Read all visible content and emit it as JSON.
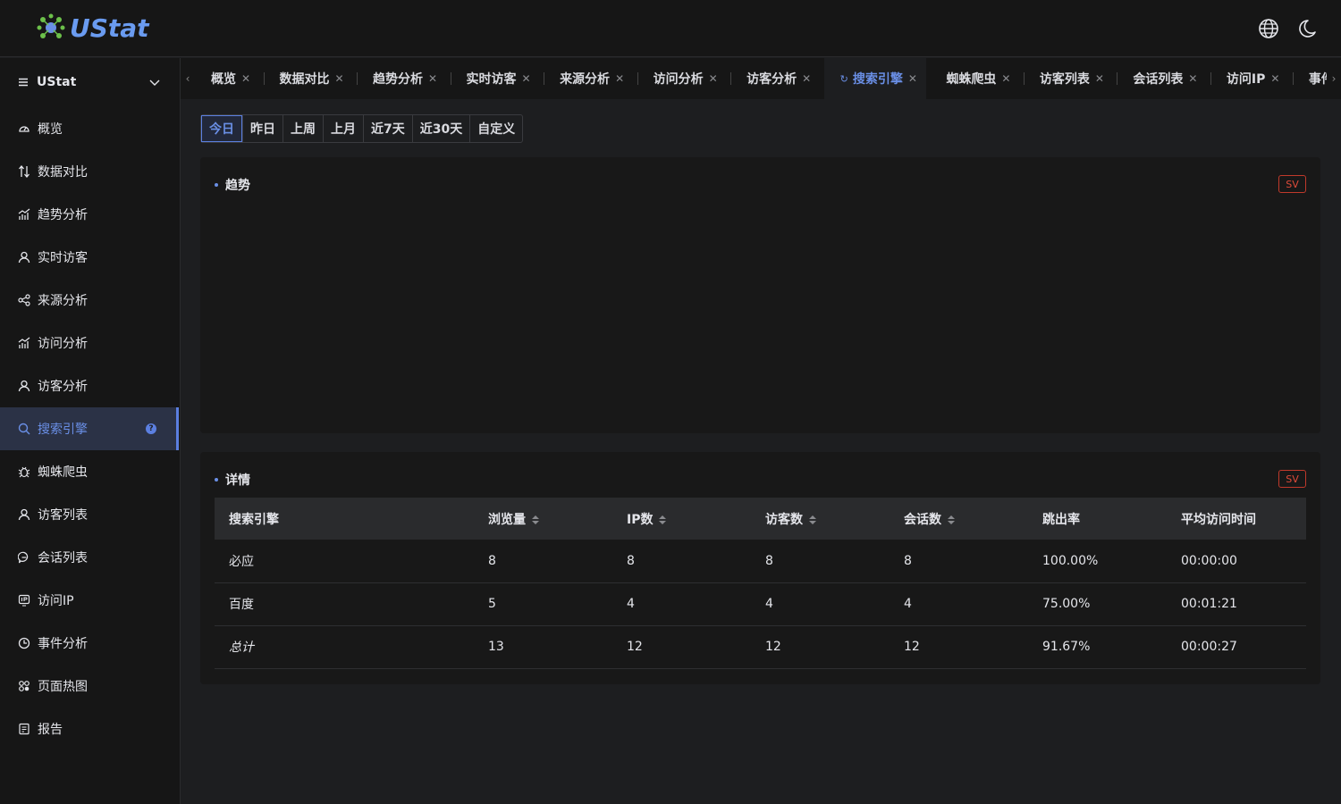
{
  "app": {
    "logo_text": "UStat"
  },
  "colors": {
    "accent": "#5b7fe0",
    "logo_green": "#6cc04a",
    "sv_red": "#e04b3a"
  },
  "sidebar": {
    "site_label": "UStat",
    "items": [
      {
        "label": "概览",
        "icon": "dashboard-icon"
      },
      {
        "label": "数据对比",
        "icon": "compare-icon"
      },
      {
        "label": "趋势分析",
        "icon": "trend-chart-icon"
      },
      {
        "label": "实时访客",
        "icon": "user-icon"
      },
      {
        "label": "来源分析",
        "icon": "share-icon"
      },
      {
        "label": "访问分析",
        "icon": "bar-chart-icon"
      },
      {
        "label": "访客分析",
        "icon": "user-icon"
      },
      {
        "label": "搜索引擎",
        "icon": "search-icon",
        "active": true
      },
      {
        "label": "蜘蛛爬虫",
        "icon": "bug-icon"
      },
      {
        "label": "访客列表",
        "icon": "user-icon"
      },
      {
        "label": "会话列表",
        "icon": "message-icon"
      },
      {
        "label": "访问IP",
        "icon": "ip-icon"
      },
      {
        "label": "事件分析",
        "icon": "clock-icon"
      },
      {
        "label": "页面热图",
        "icon": "heatmap-icon"
      },
      {
        "label": "报告",
        "icon": "report-icon"
      }
    ]
  },
  "tabs": [
    {
      "label": "概览"
    },
    {
      "label": "数据对比"
    },
    {
      "label": "趋势分析"
    },
    {
      "label": "实时访客"
    },
    {
      "label": "来源分析"
    },
    {
      "label": "访问分析"
    },
    {
      "label": "访客分析"
    },
    {
      "label": "搜索引擎",
      "active": true
    },
    {
      "label": "蜘蛛爬虫"
    },
    {
      "label": "访客列表"
    },
    {
      "label": "会话列表"
    },
    {
      "label": "访问IP"
    },
    {
      "label": "事件分析"
    }
  ],
  "ranges": [
    "今日",
    "昨日",
    "上周",
    "上月",
    "近7天",
    "近30天",
    "自定义"
  ],
  "trend": {
    "title": "趋势",
    "sv": "SV"
  },
  "details": {
    "title": "详情",
    "sv": "SV",
    "columns": [
      "搜索引擎",
      "浏览量",
      "IP数",
      "访客数",
      "会话数",
      "跳出率",
      "平均访问时间"
    ],
    "rows": [
      [
        "必应",
        "8",
        "8",
        "8",
        "8",
        "100.00%",
        "00:00:00"
      ],
      [
        "百度",
        "5",
        "4",
        "4",
        "4",
        "75.00%",
        "00:01:21"
      ]
    ],
    "total": [
      "总计",
      "13",
      "12",
      "12",
      "12",
      "91.67%",
      "00:00:27"
    ]
  }
}
